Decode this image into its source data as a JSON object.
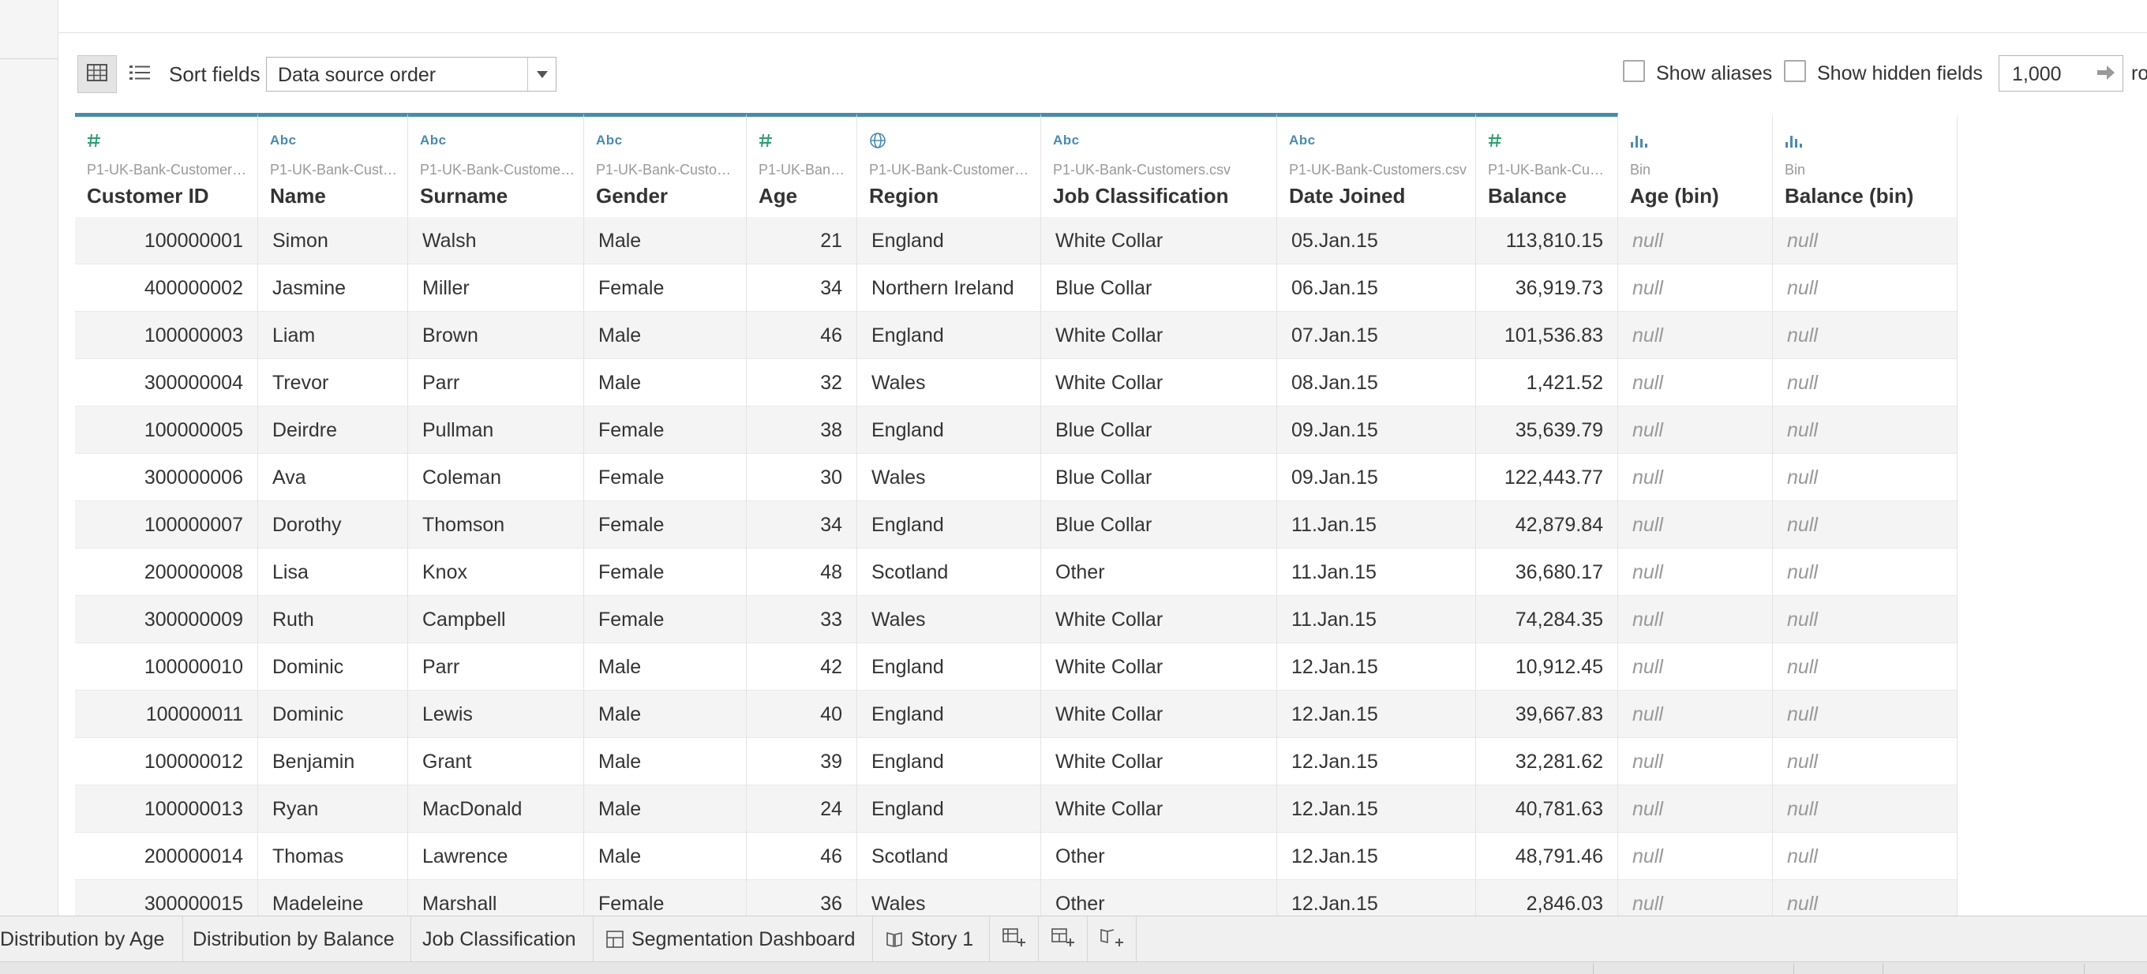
{
  "toolbar": {
    "sort_label": "Sort fields",
    "sort_value": "Data source order",
    "show_aliases_label": "Show aliases",
    "show_hidden_label": "Show hidden fields",
    "rows_value": "1,000",
    "rows_label": "ro"
  },
  "columns": [
    {
      "type": "number",
      "source": "P1-UK-Bank-Customers.csv",
      "name": "Customer ID"
    },
    {
      "type": "string",
      "source": "P1-UK-Bank-Customers.csv",
      "name": "Name"
    },
    {
      "type": "string",
      "source": "P1-UK-Bank-Customers.csv",
      "name": "Surname"
    },
    {
      "type": "string",
      "source": "P1-UK-Bank-Customers.csv",
      "name": "Gender"
    },
    {
      "type": "number",
      "source": "P1-UK-Bank-Customers.csv",
      "name": "Age"
    },
    {
      "type": "geo",
      "source": "P1-UK-Bank-Customers.csv",
      "name": "Region"
    },
    {
      "type": "string",
      "source": "P1-UK-Bank-Customers.csv",
      "name": "Job Classification"
    },
    {
      "type": "string",
      "source": "P1-UK-Bank-Customers.csv",
      "name": "Date Joined"
    },
    {
      "type": "number",
      "source": "P1-UK-Bank-Customers.csv",
      "name": "Balance"
    },
    {
      "type": "bin",
      "source": "Bin",
      "name": "Age (bin)"
    },
    {
      "type": "bin",
      "source": "Bin",
      "name": "Balance (bin)"
    }
  ],
  "rows": [
    [
      "100000001",
      "Simon",
      "Walsh",
      "Male",
      "21",
      "England",
      "White Collar",
      "05.Jan.15",
      "113,810.15",
      "null",
      "null"
    ],
    [
      "400000002",
      "Jasmine",
      "Miller",
      "Female",
      "34",
      "Northern Ireland",
      "Blue Collar",
      "06.Jan.15",
      "36,919.73",
      "null",
      "null"
    ],
    [
      "100000003",
      "Liam",
      "Brown",
      "Male",
      "46",
      "England",
      "White Collar",
      "07.Jan.15",
      "101,536.83",
      "null",
      "null"
    ],
    [
      "300000004",
      "Trevor",
      "Parr",
      "Male",
      "32",
      "Wales",
      "White Collar",
      "08.Jan.15",
      "1,421.52",
      "null",
      "null"
    ],
    [
      "100000005",
      "Deirdre",
      "Pullman",
      "Female",
      "38",
      "England",
      "Blue Collar",
      "09.Jan.15",
      "35,639.79",
      "null",
      "null"
    ],
    [
      "300000006",
      "Ava",
      "Coleman",
      "Female",
      "30",
      "Wales",
      "Blue Collar",
      "09.Jan.15",
      "122,443.77",
      "null",
      "null"
    ],
    [
      "100000007",
      "Dorothy",
      "Thomson",
      "Female",
      "34",
      "England",
      "Blue Collar",
      "11.Jan.15",
      "42,879.84",
      "null",
      "null"
    ],
    [
      "200000008",
      "Lisa",
      "Knox",
      "Female",
      "48",
      "Scotland",
      "Other",
      "11.Jan.15",
      "36,680.17",
      "null",
      "null"
    ],
    [
      "300000009",
      "Ruth",
      "Campbell",
      "Female",
      "33",
      "Wales",
      "White Collar",
      "11.Jan.15",
      "74,284.35",
      "null",
      "null"
    ],
    [
      "100000010",
      "Dominic",
      "Parr",
      "Male",
      "42",
      "England",
      "White Collar",
      "12.Jan.15",
      "10,912.45",
      "null",
      "null"
    ],
    [
      "100000011",
      "Dominic",
      "Lewis",
      "Male",
      "40",
      "England",
      "White Collar",
      "12.Jan.15",
      "39,667.83",
      "null",
      "null"
    ],
    [
      "100000012",
      "Benjamin",
      "Grant",
      "Male",
      "39",
      "England",
      "White Collar",
      "12.Jan.15",
      "32,281.62",
      "null",
      "null"
    ],
    [
      "100000013",
      "Ryan",
      "MacDonald",
      "Male",
      "24",
      "England",
      "White Collar",
      "12.Jan.15",
      "40,781.63",
      "null",
      "null"
    ],
    [
      "200000014",
      "Thomas",
      "Lawrence",
      "Male",
      "46",
      "Scotland",
      "Other",
      "12.Jan.15",
      "48,791.46",
      "null",
      "null"
    ],
    [
      "300000015",
      "Madeleine",
      "Marshall",
      "Female",
      "36",
      "Wales",
      "Other",
      "12.Jan.15",
      "2,846.03",
      "null",
      "null"
    ]
  ],
  "tabs": [
    {
      "label": "Distribution by Age",
      "icon": ""
    },
    {
      "label": "Distribution by Balance",
      "icon": ""
    },
    {
      "label": "Job Classification",
      "icon": ""
    },
    {
      "label": "Segmentation Dashboard",
      "icon": "dashboard-icon"
    },
    {
      "label": "Story 1",
      "icon": "story-icon"
    }
  ],
  "new_tab_buttons": [
    "new-worksheet-icon",
    "new-dashboard-icon",
    "new-story-icon"
  ],
  "colors": {
    "accent": "#4a8bad",
    "number_icon": "#2e9e6e",
    "null_text": "#999999",
    "row_alt": "#f4f4f4"
  }
}
